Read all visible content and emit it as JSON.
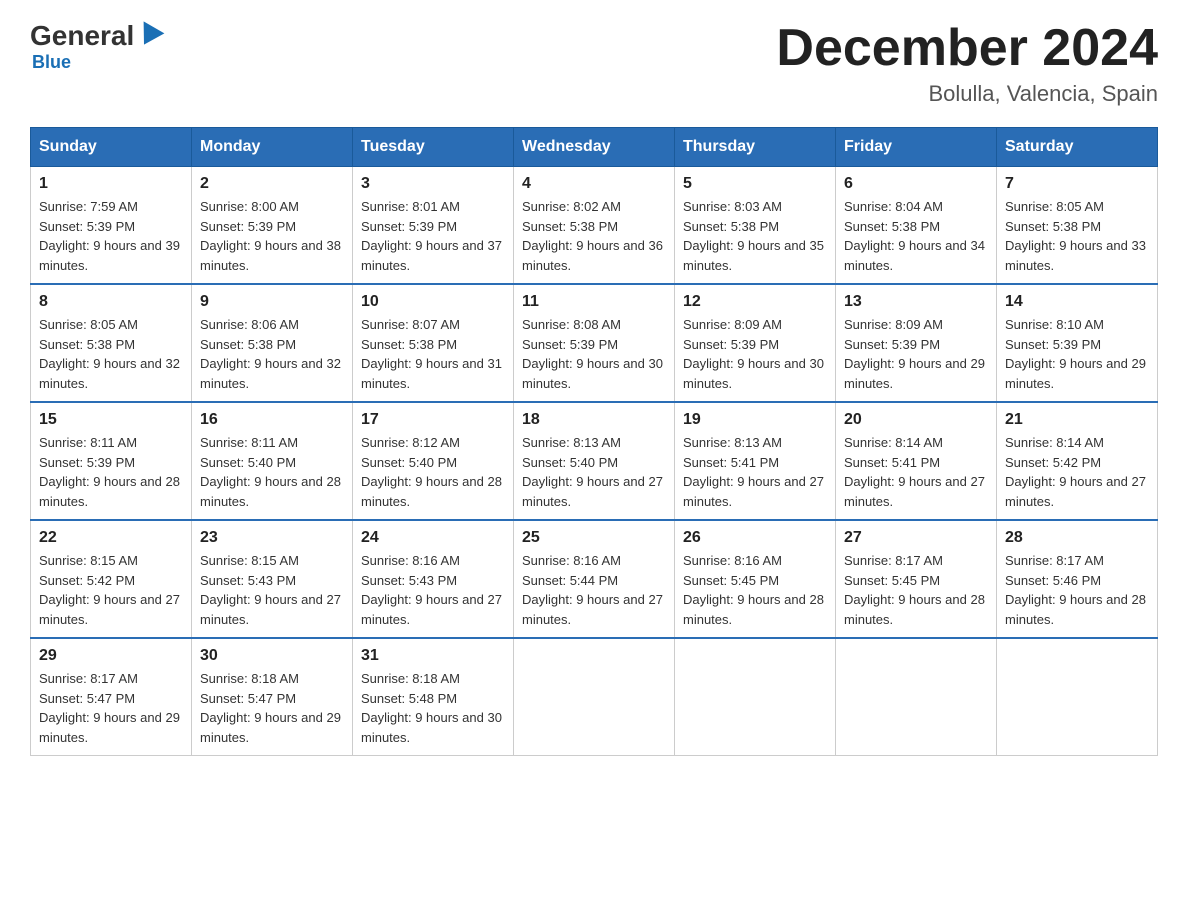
{
  "header": {
    "logo": {
      "general": "General",
      "blue": "Blue"
    },
    "title": "December 2024",
    "location": "Bolulla, Valencia, Spain"
  },
  "weekdays": [
    "Sunday",
    "Monday",
    "Tuesday",
    "Wednesday",
    "Thursday",
    "Friday",
    "Saturday"
  ],
  "weeks": [
    [
      {
        "day": "1",
        "sunrise": "7:59 AM",
        "sunset": "5:39 PM",
        "daylight": "9 hours and 39 minutes."
      },
      {
        "day": "2",
        "sunrise": "8:00 AM",
        "sunset": "5:39 PM",
        "daylight": "9 hours and 38 minutes."
      },
      {
        "day": "3",
        "sunrise": "8:01 AM",
        "sunset": "5:39 PM",
        "daylight": "9 hours and 37 minutes."
      },
      {
        "day": "4",
        "sunrise": "8:02 AM",
        "sunset": "5:38 PM",
        "daylight": "9 hours and 36 minutes."
      },
      {
        "day": "5",
        "sunrise": "8:03 AM",
        "sunset": "5:38 PM",
        "daylight": "9 hours and 35 minutes."
      },
      {
        "day": "6",
        "sunrise": "8:04 AM",
        "sunset": "5:38 PM",
        "daylight": "9 hours and 34 minutes."
      },
      {
        "day": "7",
        "sunrise": "8:05 AM",
        "sunset": "5:38 PM",
        "daylight": "9 hours and 33 minutes."
      }
    ],
    [
      {
        "day": "8",
        "sunrise": "8:05 AM",
        "sunset": "5:38 PM",
        "daylight": "9 hours and 32 minutes."
      },
      {
        "day": "9",
        "sunrise": "8:06 AM",
        "sunset": "5:38 PM",
        "daylight": "9 hours and 32 minutes."
      },
      {
        "day": "10",
        "sunrise": "8:07 AM",
        "sunset": "5:38 PM",
        "daylight": "9 hours and 31 minutes."
      },
      {
        "day": "11",
        "sunrise": "8:08 AM",
        "sunset": "5:39 PM",
        "daylight": "9 hours and 30 minutes."
      },
      {
        "day": "12",
        "sunrise": "8:09 AM",
        "sunset": "5:39 PM",
        "daylight": "9 hours and 30 minutes."
      },
      {
        "day": "13",
        "sunrise": "8:09 AM",
        "sunset": "5:39 PM",
        "daylight": "9 hours and 29 minutes."
      },
      {
        "day": "14",
        "sunrise": "8:10 AM",
        "sunset": "5:39 PM",
        "daylight": "9 hours and 29 minutes."
      }
    ],
    [
      {
        "day": "15",
        "sunrise": "8:11 AM",
        "sunset": "5:39 PM",
        "daylight": "9 hours and 28 minutes."
      },
      {
        "day": "16",
        "sunrise": "8:11 AM",
        "sunset": "5:40 PM",
        "daylight": "9 hours and 28 minutes."
      },
      {
        "day": "17",
        "sunrise": "8:12 AM",
        "sunset": "5:40 PM",
        "daylight": "9 hours and 28 minutes."
      },
      {
        "day": "18",
        "sunrise": "8:13 AM",
        "sunset": "5:40 PM",
        "daylight": "9 hours and 27 minutes."
      },
      {
        "day": "19",
        "sunrise": "8:13 AM",
        "sunset": "5:41 PM",
        "daylight": "9 hours and 27 minutes."
      },
      {
        "day": "20",
        "sunrise": "8:14 AM",
        "sunset": "5:41 PM",
        "daylight": "9 hours and 27 minutes."
      },
      {
        "day": "21",
        "sunrise": "8:14 AM",
        "sunset": "5:42 PM",
        "daylight": "9 hours and 27 minutes."
      }
    ],
    [
      {
        "day": "22",
        "sunrise": "8:15 AM",
        "sunset": "5:42 PM",
        "daylight": "9 hours and 27 minutes."
      },
      {
        "day": "23",
        "sunrise": "8:15 AM",
        "sunset": "5:43 PM",
        "daylight": "9 hours and 27 minutes."
      },
      {
        "day": "24",
        "sunrise": "8:16 AM",
        "sunset": "5:43 PM",
        "daylight": "9 hours and 27 minutes."
      },
      {
        "day": "25",
        "sunrise": "8:16 AM",
        "sunset": "5:44 PM",
        "daylight": "9 hours and 27 minutes."
      },
      {
        "day": "26",
        "sunrise": "8:16 AM",
        "sunset": "5:45 PM",
        "daylight": "9 hours and 28 minutes."
      },
      {
        "day": "27",
        "sunrise": "8:17 AM",
        "sunset": "5:45 PM",
        "daylight": "9 hours and 28 minutes."
      },
      {
        "day": "28",
        "sunrise": "8:17 AM",
        "sunset": "5:46 PM",
        "daylight": "9 hours and 28 minutes."
      }
    ],
    [
      {
        "day": "29",
        "sunrise": "8:17 AM",
        "sunset": "5:47 PM",
        "daylight": "9 hours and 29 minutes."
      },
      {
        "day": "30",
        "sunrise": "8:18 AM",
        "sunset": "5:47 PM",
        "daylight": "9 hours and 29 minutes."
      },
      {
        "day": "31",
        "sunrise": "8:18 AM",
        "sunset": "5:48 PM",
        "daylight": "9 hours and 30 minutes."
      },
      null,
      null,
      null,
      null
    ]
  ],
  "labels": {
    "sunrise_prefix": "Sunrise: ",
    "sunset_prefix": "Sunset: ",
    "daylight_prefix": "Daylight: "
  }
}
